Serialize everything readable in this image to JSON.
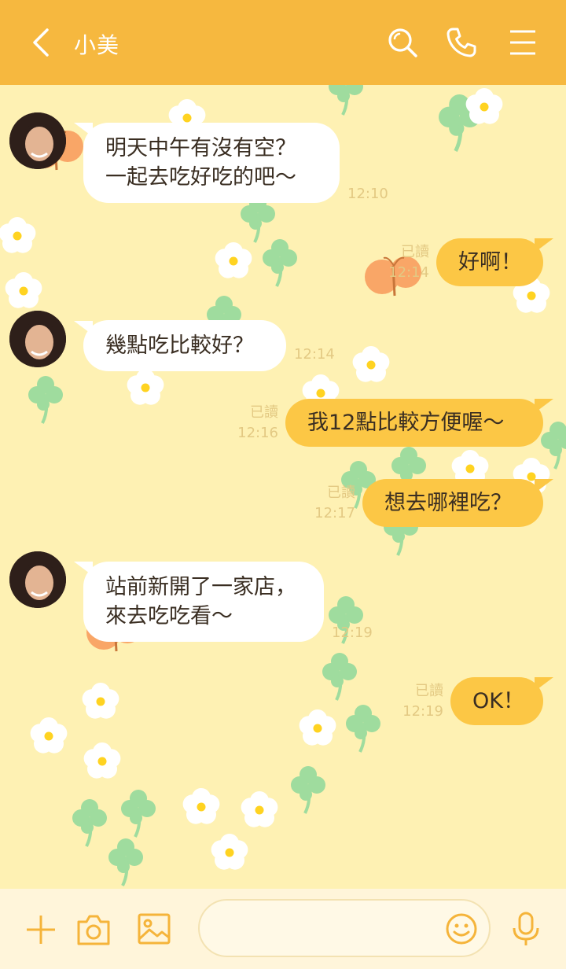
{
  "header": {
    "title": "小美",
    "back_icon": "chevron-left-icon",
    "search_icon": "search-icon",
    "call_icon": "phone-icon",
    "menu_icon": "hamburger-menu-icon"
  },
  "colors": {
    "header_bg": "#f6b83f",
    "chat_bg": "#fef1b3",
    "outgoing_bubble": "#fcc745",
    "incoming_bubble": "#ffffff",
    "meta_text": "#e3c983",
    "footer_bg": "#fff5da",
    "icon_accent": "#f5b43a"
  },
  "messages": [
    {
      "direction": "in",
      "lines": [
        "明天中午有沒有空？",
        "一起去吃好吃的吧～"
      ],
      "time": "12:10"
    },
    {
      "direction": "out",
      "lines": [
        "好啊！"
      ],
      "read": "已讀",
      "time": "12:14"
    },
    {
      "direction": "in",
      "lines": [
        "幾點吃比較好？"
      ],
      "time": "12:14"
    },
    {
      "direction": "out",
      "lines": [
        "我12點比較方便喔～"
      ],
      "read": "已讀",
      "time": "12:16"
    },
    {
      "direction": "out",
      "lines": [
        "想去哪裡吃？"
      ],
      "read": "已讀",
      "time": "12:17"
    },
    {
      "direction": "in",
      "lines": [
        "站前新開了一家店，",
        "來去吃吃看～"
      ],
      "time": "12:19"
    },
    {
      "direction": "out",
      "lines": [
        "OK！"
      ],
      "read": "已讀",
      "time": "12:19"
    }
  ],
  "footer": {
    "add_icon": "plus-icon",
    "camera_icon": "camera-icon",
    "image_icon": "image-icon",
    "input_value": "",
    "emoji_icon": "smiley-icon",
    "voice_icon": "microphone-icon"
  }
}
